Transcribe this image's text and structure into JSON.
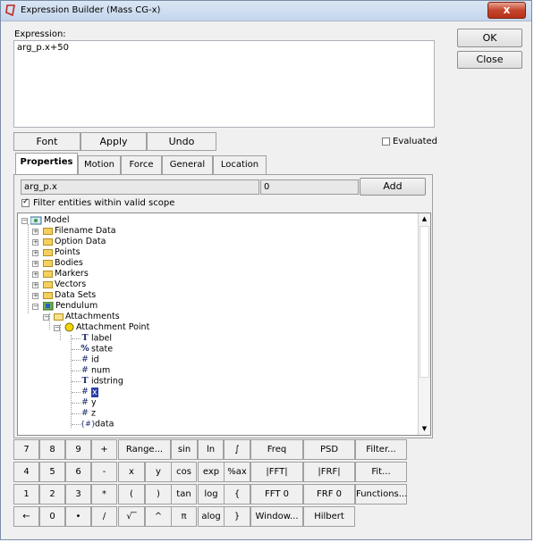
{
  "window": {
    "title": "Expression Builder (Mass CG-x)",
    "close_glyph": "x"
  },
  "expression": {
    "label": "Expression:",
    "value": "arg_p.x+50"
  },
  "side_buttons": {
    "ok": "OK",
    "close": "Close"
  },
  "edit_buttons": {
    "font": "Font",
    "apply": "Apply",
    "undo": "Undo"
  },
  "evaluated": {
    "label": "Evaluated",
    "checked": false
  },
  "tabs": [
    "Properties",
    "Motion",
    "Force",
    "General",
    "Location"
  ],
  "properties": {
    "path_value": "arg_p.x",
    "index_value": "0",
    "add_label": "Add",
    "filter_label": "Filter entities within valid scope",
    "filter_checked": true
  },
  "tree": {
    "model": "Model",
    "folders": [
      "Filename Data",
      "Option Data",
      "Points",
      "Bodies",
      "Markers",
      "Vectors",
      "Data Sets"
    ],
    "pendulum": "Pendulum",
    "attachments": "Attachments",
    "attachment_point": "Attachment Point",
    "props": [
      {
        "icon": "T",
        "label": "label"
      },
      {
        "icon": "%",
        "label": "state"
      },
      {
        "icon": "#",
        "label": "id"
      },
      {
        "icon": "#",
        "label": "num"
      },
      {
        "icon": "T",
        "label": "idstring"
      },
      {
        "icon": "#",
        "label": "x"
      },
      {
        "icon": "#",
        "label": "y"
      },
      {
        "icon": "#",
        "label": "z"
      },
      {
        "icon": "{#}",
        "label": "data"
      }
    ]
  },
  "keypad": {
    "rows": [
      [
        "7",
        "8",
        "9",
        "+",
        "Range...",
        "sin",
        "ln",
        "∫",
        "Freq",
        "PSD",
        "Filter..."
      ],
      [
        "4",
        "5",
        "6",
        "-",
        "x",
        "y",
        "cos",
        "exp",
        "%ax",
        "|FFT|",
        "|FRF|",
        "Fit..."
      ],
      [
        "1",
        "2",
        "3",
        "*",
        "(",
        ")",
        "tan",
        "log",
        "{",
        "FFT 0",
        "FRF 0",
        "Functions..."
      ],
      [
        "←",
        "0",
        "•",
        "/",
        "√‾",
        "^",
        "π",
        "alog",
        "}",
        "Window...",
        "Hilbert"
      ]
    ]
  }
}
